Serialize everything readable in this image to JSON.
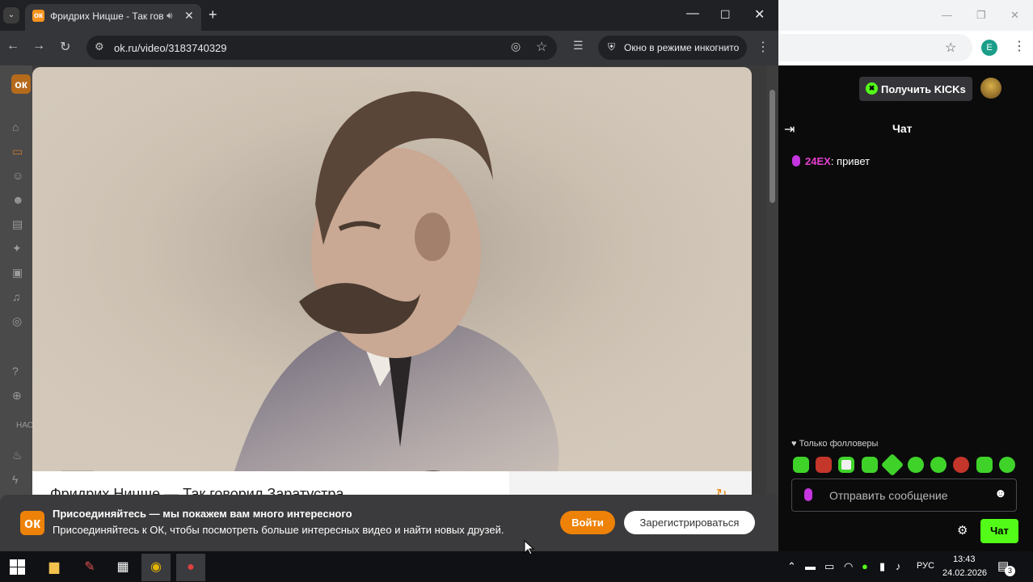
{
  "left_browser": {
    "tab": {
      "favicon": "ok-logo",
      "title": "Фридрих Ницше - Так говорил Заратустра",
      "audio_icon": "speaker-icon"
    },
    "window_controls": {
      "minimize": "—",
      "maximize": "☐",
      "close": "✕"
    },
    "url": "ok.ru/video/3183740329",
    "incognito_label": "Окно в режиме инкогнито"
  },
  "video": {
    "overlay_title": "Так говорил Заратустра",
    "page_title_cut": "Фридрих Ницше — Так говорил Заратустра"
  },
  "sidebar_cut_label": "НАС",
  "banner": {
    "heading": "Присоединяйтесь — мы покажем вам много интересного",
    "text": "Присоединяйтесь к ОК, чтобы посмотреть больше интересных видео и найти новых друзей.",
    "login": "Войти",
    "register": "Зарегистрироваться"
  },
  "right_browser": {
    "avatar_letter": "E",
    "kicks_button": "Получить KICKs",
    "chat_title": "Чат",
    "messages": [
      {
        "user": "24EX",
        "text": ": привет"
      }
    ],
    "followers_only": "Только фолловеры",
    "input_placeholder": "Отправить сообщение",
    "send_label": "Чат"
  },
  "taskbar": {
    "lang": "РУС",
    "time": "13:43",
    "date": "24.02.2026",
    "notifications": "3"
  },
  "colors": {
    "ok_orange": "#ee8208",
    "kick_green": "#53fc18",
    "mention_pink": "#e63fd0"
  }
}
